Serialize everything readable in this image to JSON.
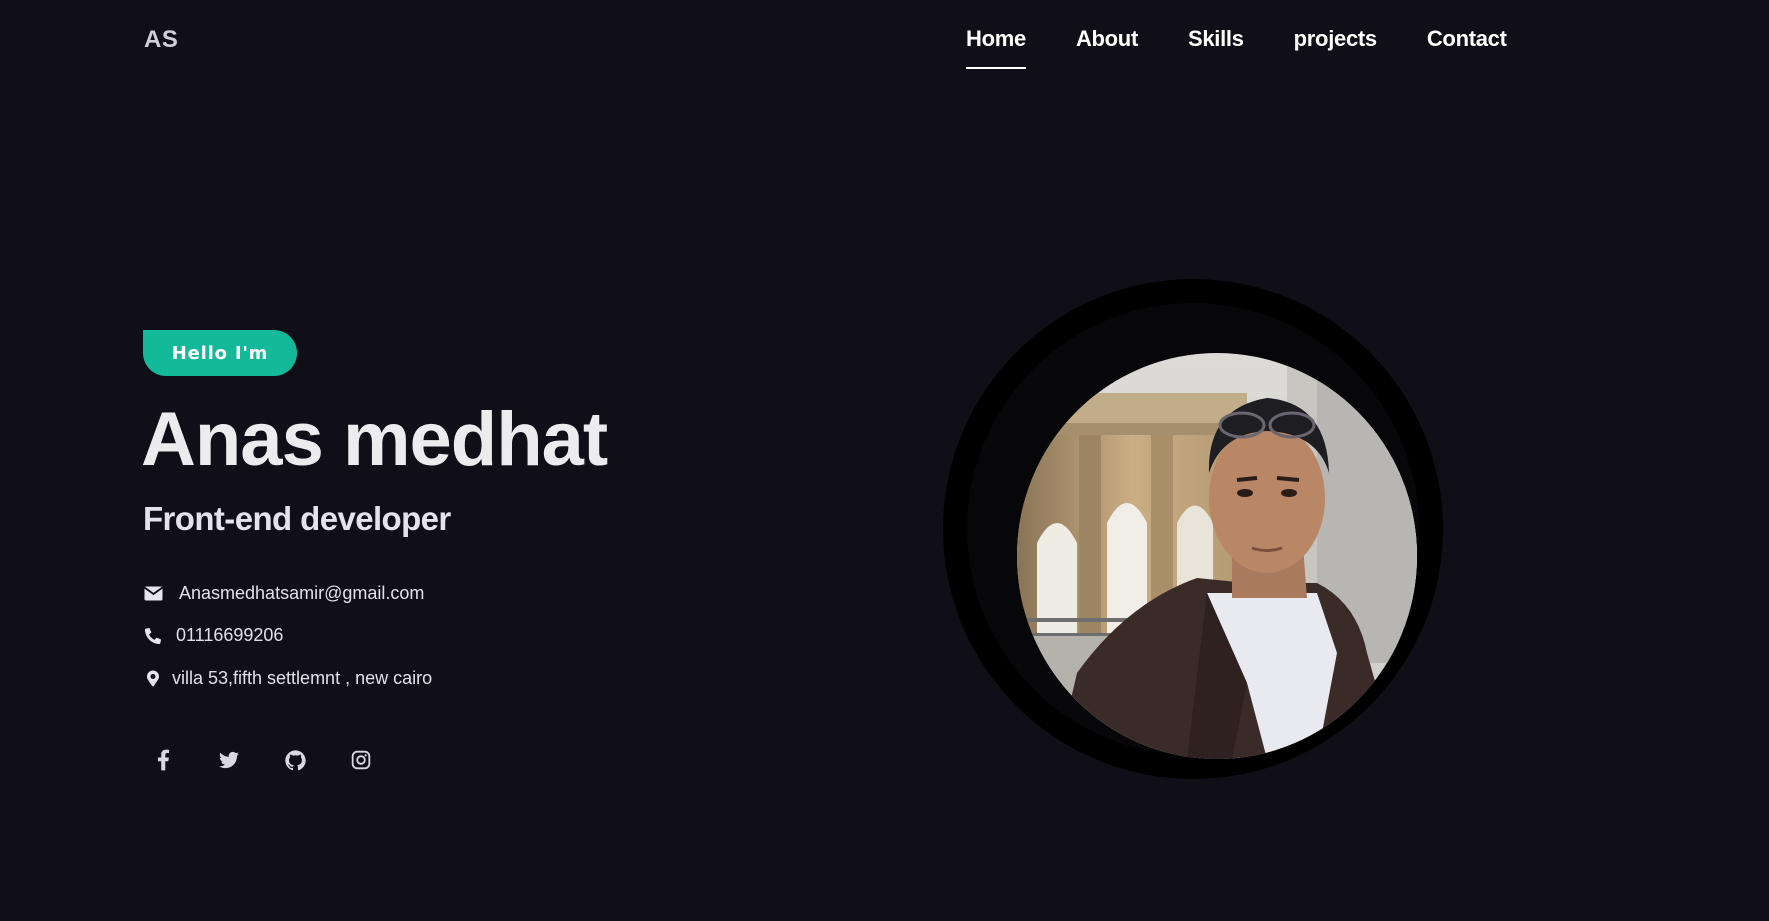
{
  "header": {
    "logo": "AS",
    "nav": [
      {
        "label": "Home",
        "active": true
      },
      {
        "label": "About",
        "active": false
      },
      {
        "label": "Skills",
        "active": false
      },
      {
        "label": "projects",
        "active": false
      },
      {
        "label": "Contact",
        "active": false
      }
    ]
  },
  "hero": {
    "badge": "Hello I'm",
    "name": "Anas medhat",
    "role": "Front-end developer",
    "contacts": {
      "email": {
        "icon": "envelope-icon",
        "text": "Anasmedhatsamir@gmail.com"
      },
      "phone": {
        "icon": "phone-icon",
        "text": "01116699206"
      },
      "address": {
        "icon": "map-pin-icon",
        "text": "villa 53,fifth settlemnt , new cairo"
      }
    },
    "socials": [
      "facebook-icon",
      "twitter-icon",
      "github-icon",
      "instagram-icon"
    ]
  },
  "colors": {
    "background": "#100f18",
    "accent": "#14b99a",
    "text": "#eceaf0"
  }
}
